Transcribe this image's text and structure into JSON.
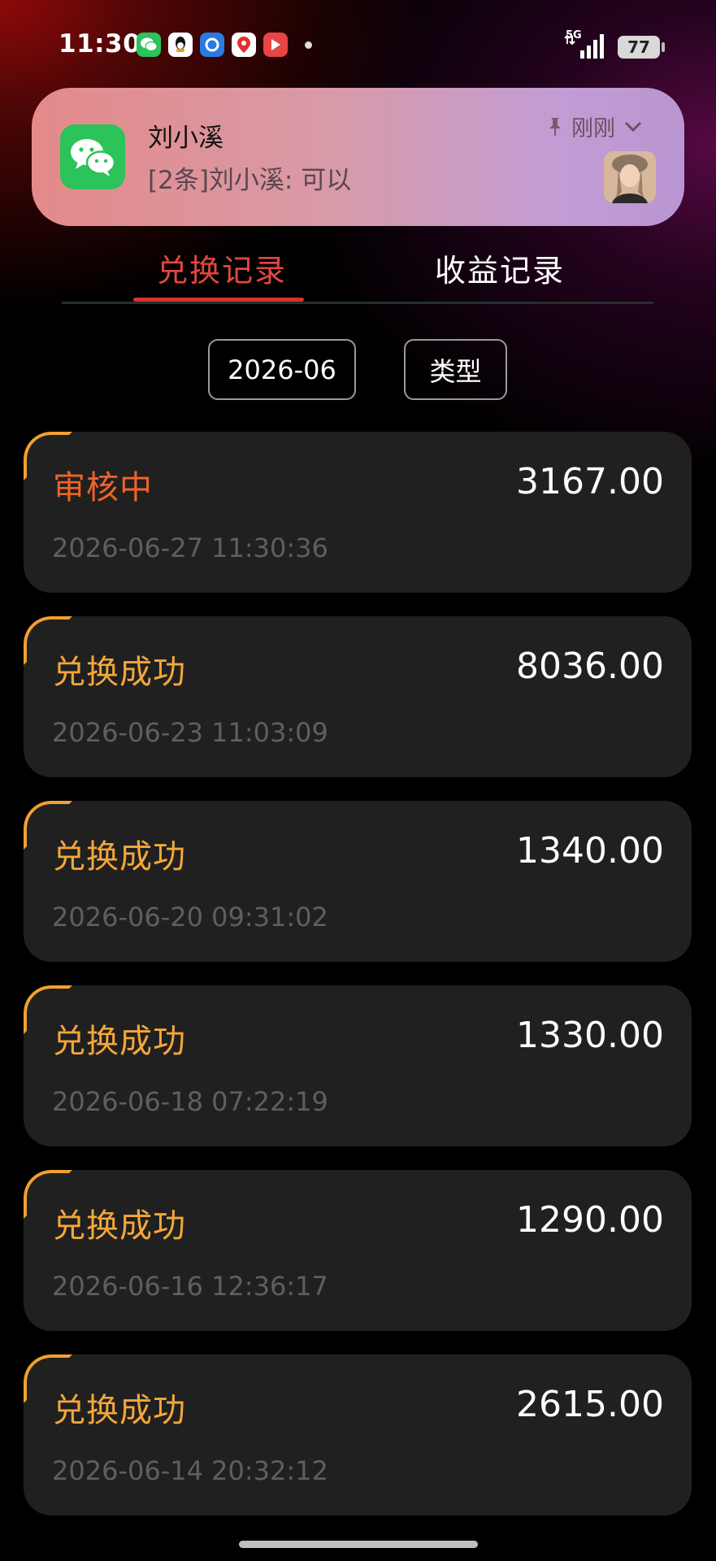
{
  "status_bar": {
    "time": "11:30",
    "network": "5G",
    "battery": "77",
    "apps": [
      "wechat-icon",
      "qq-icon",
      "app-icon",
      "map-icon",
      "video-icon"
    ]
  },
  "notification": {
    "app_icon": "wechat-icon",
    "sender": "刘小溪",
    "message": "[2条]刘小溪: 可以",
    "time": "刚刚"
  },
  "tabs": {
    "active": "兑换记录",
    "inactive": "收益记录"
  },
  "filters": {
    "month": "2026-06",
    "type": "类型"
  },
  "records": [
    {
      "status": "审核中",
      "amount": "3167.00",
      "time": "2026-06-27 11:30:36"
    },
    {
      "status": "兑换成功",
      "amount": "8036.00",
      "time": "2026-06-23 11:03:09"
    },
    {
      "status": "兑换成功",
      "amount": "1340.00",
      "time": "2026-06-20 09:31:02"
    },
    {
      "status": "兑换成功",
      "amount": "1330.00",
      "time": "2026-06-18 07:22:19"
    },
    {
      "status": "兑换成功",
      "amount": "1290.00",
      "time": "2026-06-16 12:36:17"
    },
    {
      "status": "兑换成功",
      "amount": "2615.00",
      "time": "2026-06-14 20:32:12"
    }
  ],
  "colors": {
    "accent_red": "#e2473f",
    "pending": "#ef6328",
    "success": "#f4a73a",
    "card": "#202020"
  }
}
